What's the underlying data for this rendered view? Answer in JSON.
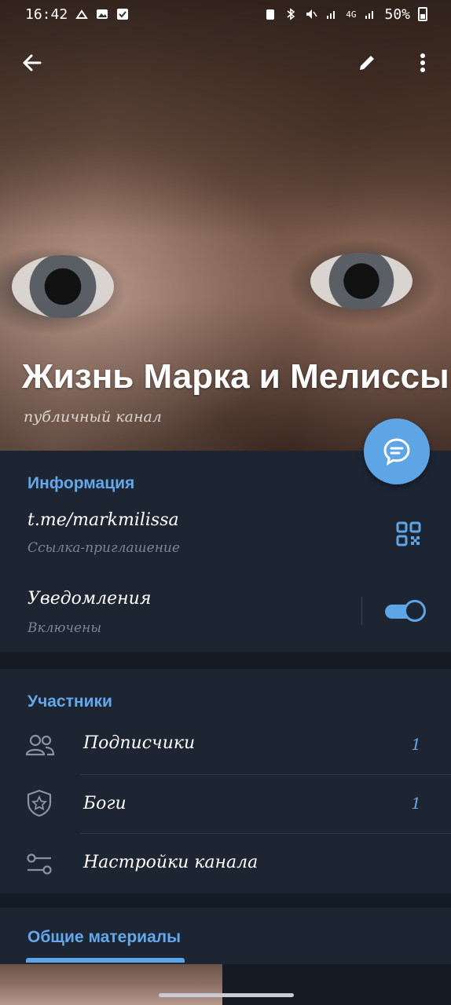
{
  "status_bar": {
    "time": "16:42",
    "battery": "50%",
    "network": "4G"
  },
  "header": {
    "title": "Жизнь Марка и Мелиссы",
    "subtitle": "публичный канал",
    "icons": [
      "back-arrow-icon",
      "pencil-icon",
      "more-vert-icon",
      "chat-icon"
    ]
  },
  "info": {
    "heading": "Информация",
    "link": "t.me/markmilissa",
    "link_caption": "Ссылка-приглашение",
    "notifications_label": "Уведомления",
    "notifications_state": "Включены",
    "notifications_on": true
  },
  "members": {
    "heading": "Участники",
    "items": [
      {
        "label": "Подписчики",
        "count": "1",
        "icon": "people-icon"
      },
      {
        "label": "Боги",
        "count": "1",
        "icon": "shield-star-icon"
      },
      {
        "label": "Настройки канала",
        "count": "",
        "icon": "sliders-icon"
      }
    ]
  },
  "shared": {
    "heading": "Общие материалы"
  },
  "colors": {
    "accent": "#5ea5e5",
    "background": "#1d2533",
    "separator": "#151b24"
  }
}
